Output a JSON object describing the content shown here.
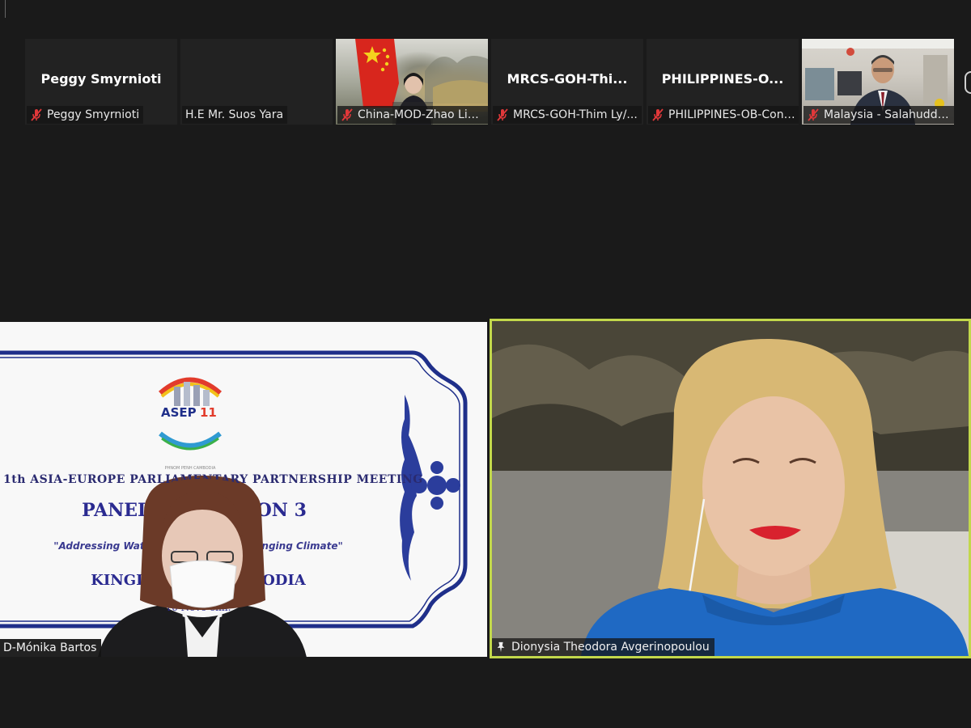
{
  "thumbnails": [
    {
      "center_name": "Peggy Smyrnioti",
      "label": "Peggy Smyrnioti",
      "muted": true,
      "video": false
    },
    {
      "center_name": "",
      "label": "H.E Mr. Suos Yara",
      "muted": false,
      "video": false
    },
    {
      "center_name": "",
      "label": "China-MOD-Zhao Lixin !",
      "muted": true,
      "video": true
    },
    {
      "center_name": "MRCS-GOH-Thi...",
      "label": "MRCS-GOH-Thim Ly/...",
      "muted": true,
      "video": false
    },
    {
      "center_name": "PHILIPPINES-O...",
      "label": "PHILIPPINES-OB-Cons...",
      "muted": true,
      "video": false
    },
    {
      "center_name": "",
      "label": "Malaysia - Salahuddi...",
      "muted": true,
      "video": true
    }
  ],
  "left_tile": {
    "name": "D-Mónika Bartos",
    "slide": {
      "logo_text": "ASEP",
      "logo_number": "11",
      "line1": "1th ASIA-EUROPE PARLIAMENTARY PARTNERSHIP MEETING",
      "line2": "PANEL DISCUSSION 3",
      "line3": "\"Addressing Water-Energy-                      under Changing Climate\"",
      "line4": "KINGDOM OF CAMBODIA",
      "line5": "16 Nove                            enh."
    }
  },
  "right_tile": {
    "name": "Dionysia Theodora Avgerinopoulou",
    "active_speaker": true
  },
  "colors": {
    "background": "#1a1a1a",
    "tile": "#222222",
    "active_speaker_border": "#c2d84b",
    "muted_icon": "#e0383a",
    "slide_navy": "#2a2a90"
  }
}
